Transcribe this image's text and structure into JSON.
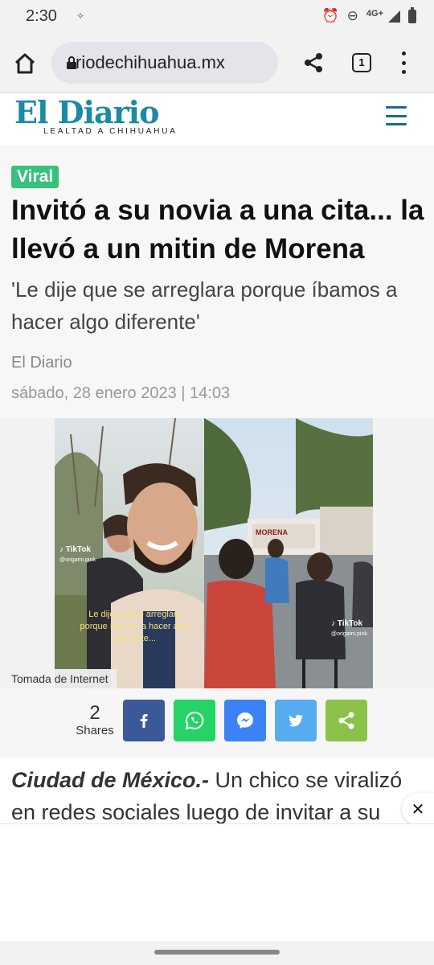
{
  "status_bar": {
    "time": "2:30",
    "indicator": "✧",
    "network": "4G+"
  },
  "browser": {
    "url": "riodechihuahua.mx",
    "tab_count": "1"
  },
  "site": {
    "logo_text": "El Diario",
    "tagline": "LEALTAD A CHIHUAHUA",
    "brand_color": "#1c8aa5"
  },
  "article": {
    "category": "Viral",
    "headline": "Invitó a su novia a una cita... la llevó a un mitin de Morena",
    "subheadline": "'Le dije que se arreglara porque íbamos a hacer algo diferente'",
    "author": "El Diario",
    "date": "sábado, 28 enero 2023 | 14:03",
    "image_credit": "Tomada de Internet",
    "image_overlay": {
      "caption": "Le dije que se arreglara porque íbamos a hacer algo diferente...",
      "tiktok_label": "TikTok",
      "tiktok_handle": "@origami.pink",
      "banner": "MORENA"
    },
    "body_lead": "Ciudad de México.-",
    "body_text": " Un chico se viralizó en redes sociales luego de invitar a su"
  },
  "share": {
    "count": "2",
    "label": "Shares",
    "buttons": [
      {
        "name": "facebook",
        "color": "#3b5998"
      },
      {
        "name": "whatsapp",
        "color": "#25d366"
      },
      {
        "name": "messenger",
        "color": "#3b82f6"
      },
      {
        "name": "twitter",
        "color": "#55acee"
      },
      {
        "name": "sharethis",
        "color": "#8bc34a"
      }
    ]
  },
  "close_label": "✕"
}
